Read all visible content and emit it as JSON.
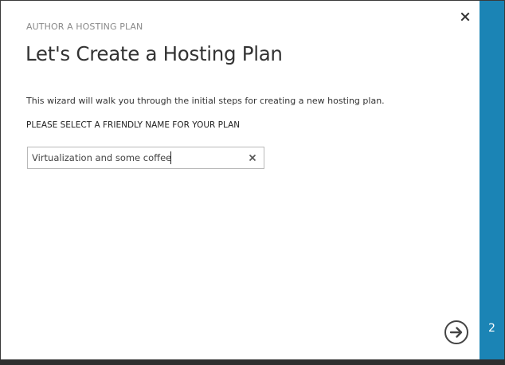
{
  "dialog": {
    "eyebrow": "AUTHOR A HOSTING PLAN",
    "title": "Let's Create a Hosting Plan",
    "description": "This wizard will walk you through the initial steps for creating a new hosting plan.",
    "field_label": "PLEASE SELECT A FRIENDLY NAME FOR YOUR PLAN",
    "name_input": {
      "value": "Virtualization and some coffee",
      "clear_icon": "close-icon"
    },
    "close_icon": "close-icon",
    "next_icon": "arrow-right-circle-icon"
  },
  "wizard": {
    "step": "2"
  },
  "colors": {
    "accent": "#1b84b5",
    "background": "#ffffff",
    "text": "#333333",
    "muted": "#8a8a8a"
  }
}
